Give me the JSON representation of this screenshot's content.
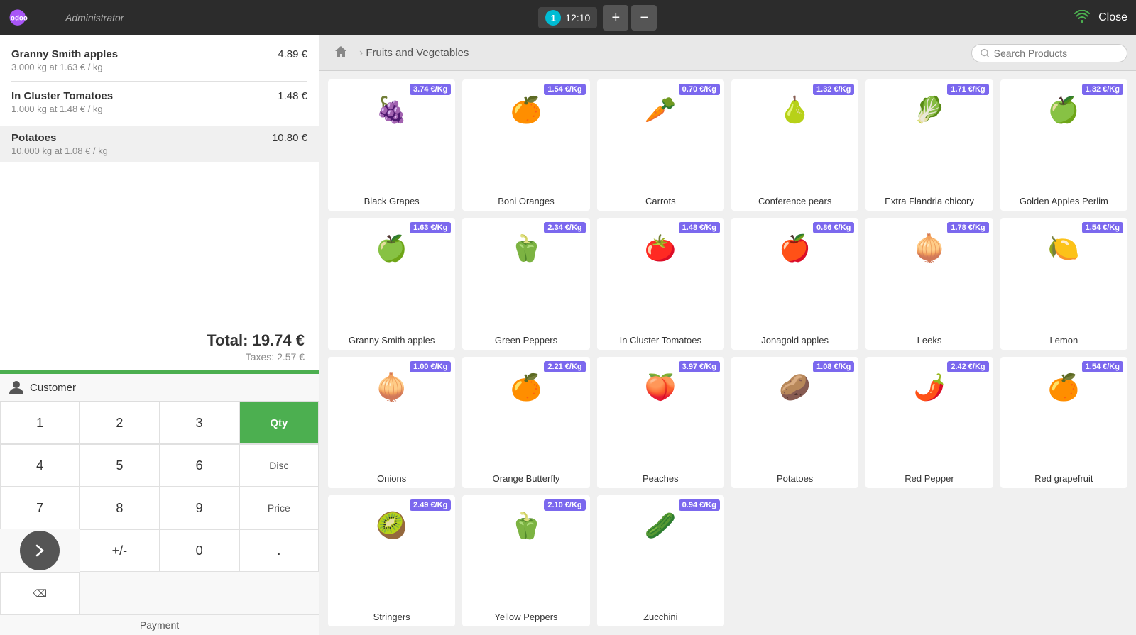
{
  "topbar": {
    "logo_text": "odoo",
    "admin_label": "Administrator",
    "order_num": "1",
    "order_time": "12:10",
    "add_btn": "+",
    "remove_btn": "−",
    "close_label": "Close"
  },
  "breadcrumb": {
    "category": "Fruits and Vegetables",
    "search_placeholder": "Search Products"
  },
  "order": {
    "items": [
      {
        "name": "Granny Smith apples",
        "price": "4.89 €",
        "detail": "3.000 kg at 1.63 € / kg"
      },
      {
        "name": "In Cluster Tomatoes",
        "price": "1.48 €",
        "detail": "1.000 kg at 1.48 € / kg"
      },
      {
        "name": "Potatoes",
        "price": "10.80 €",
        "detail": "10.000 kg at 1.08 € / kg",
        "selected": true
      }
    ],
    "total": "Total: 19.74 €",
    "taxes": "Taxes: 2.57 €"
  },
  "numpad": {
    "customer_label": "Customer",
    "keys": [
      "1",
      "2",
      "3",
      "4",
      "5",
      "6",
      "7",
      "8",
      "9",
      "+/-",
      "0",
      "."
    ],
    "qty_label": "Qty",
    "disc_label": "Disc",
    "price_label": "Price",
    "backspace": "⌫",
    "payment_label": "Payment"
  },
  "products": [
    {
      "name": "Black Grapes",
      "price": "3.74 €/Kg",
      "emoji": "🍇"
    },
    {
      "name": "Boni Oranges",
      "price": "1.54 €/Kg",
      "emoji": "🍊"
    },
    {
      "name": "Carrots",
      "price": "0.70 €/Kg",
      "emoji": "🥕"
    },
    {
      "name": "Conference pears",
      "price": "1.32 €/Kg",
      "emoji": "🍐"
    },
    {
      "name": "Extra Flandria chicory",
      "price": "1.71 €/Kg",
      "emoji": "🥬"
    },
    {
      "name": "Golden Apples Perlim",
      "price": "1.32 €/Kg",
      "emoji": "🍏"
    },
    {
      "name": "Granny Smith apples",
      "price": "1.63 €/Kg",
      "emoji": "🍏"
    },
    {
      "name": "Green Peppers",
      "price": "2.34 €/Kg",
      "emoji": "🫑"
    },
    {
      "name": "In Cluster Tomatoes",
      "price": "1.48 €/Kg",
      "emoji": "🍅"
    },
    {
      "name": "Jonagold apples",
      "price": "0.86 €/Kg",
      "emoji": "🍎"
    },
    {
      "name": "Leeks",
      "price": "1.78 €/Kg",
      "emoji": "🧅"
    },
    {
      "name": "Lemon",
      "price": "1.54 €/Kg",
      "emoji": "🍋"
    },
    {
      "name": "Onions",
      "price": "1.00 €/Kg",
      "emoji": "🧅"
    },
    {
      "name": "Orange Butterfly",
      "price": "2.21 €/Kg",
      "emoji": "🍊"
    },
    {
      "name": "Peaches",
      "price": "3.97 €/Kg",
      "emoji": "🍑"
    },
    {
      "name": "Potatoes",
      "price": "1.08 €/Kg",
      "emoji": "🥔"
    },
    {
      "name": "Red Pepper",
      "price": "2.42 €/Kg",
      "emoji": "🌶️"
    },
    {
      "name": "Red grapefruit",
      "price": "1.54 €/Kg",
      "emoji": "🍊"
    },
    {
      "name": "Stringers",
      "price": "2.49 €/Kg",
      "emoji": "🥝"
    },
    {
      "name": "Yellow Peppers",
      "price": "2.10 €/Kg",
      "emoji": "🫑"
    },
    {
      "name": "Zucchini",
      "price": "0.94 €/Kg",
      "emoji": "🥒"
    }
  ]
}
